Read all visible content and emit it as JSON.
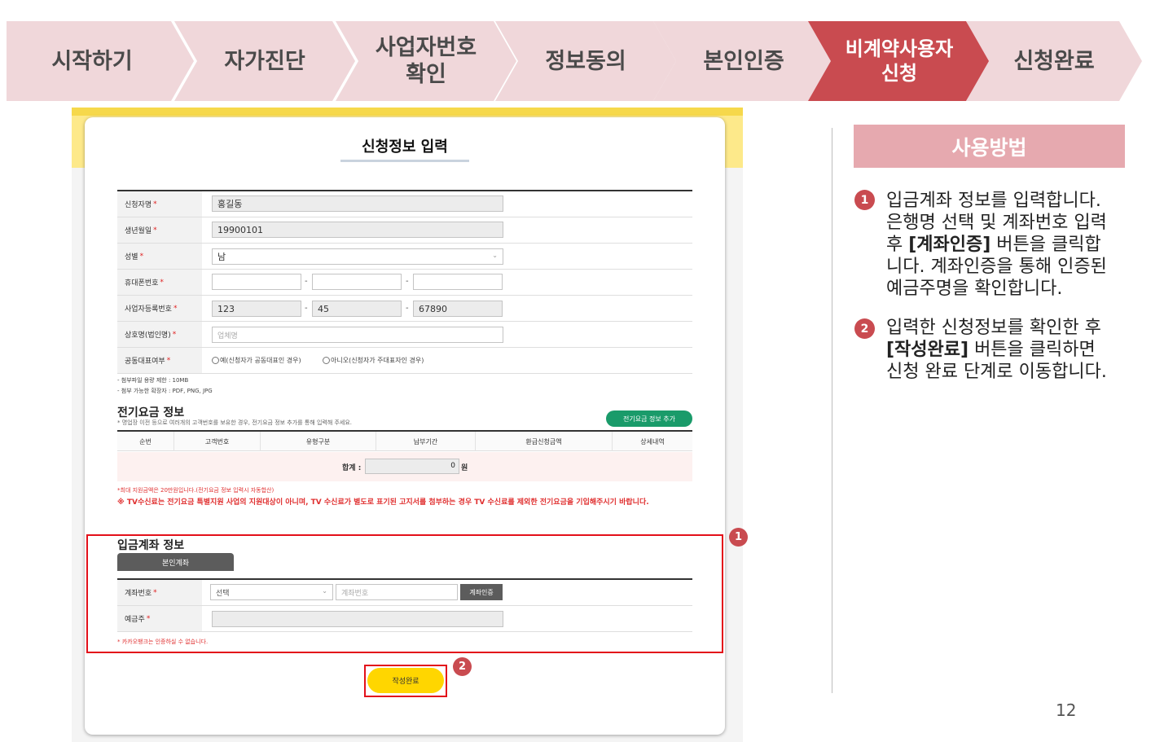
{
  "steps": [
    {
      "label": "시작하기"
    },
    {
      "label": "자가진단"
    },
    {
      "label": "사업자번호\n확인"
    },
    {
      "label": "정보동의"
    },
    {
      "label": "본인인증"
    },
    {
      "label": "비계약사용자\n신청",
      "active": true
    },
    {
      "label": "신청완료"
    }
  ],
  "colors": {
    "active_step": "#c94b50",
    "inactive_step": "#f0d7da",
    "highlight_box": "#e3101a",
    "submit_button": "#ffd600",
    "add_button": "#1a9b6a"
  },
  "form": {
    "title": "신청정보 입력",
    "applicant_name_label": "신청자명",
    "applicant_name_value": "홍길동",
    "birth_label": "생년월일",
    "birth_value": "19900101",
    "gender_label": "성별",
    "gender_value": "남",
    "phone_label": "휴대폰번호",
    "business_no_label": "사업자등록번호",
    "business_no": [
      "123",
      "45",
      "67890"
    ],
    "company_label": "상호명(법인명)",
    "company_placeholder": "업체명",
    "joint_rep_label": "공동대표여부",
    "joint_rep_yes": "예(신청자가 공동대표인 경우)",
    "joint_rep_no": "아니오(신청자가 주대표자인 경우)",
    "required_mark": "*",
    "dash": "-",
    "file_note_1": "- 첨부파일 용량 제한 : 10MB",
    "file_note_2": "- 첨부 가능한 확장자 : PDF, PNG, JPG"
  },
  "electric": {
    "title": "전기요금 정보",
    "subtitle": "* 명업장 이전 등으로 여러개의 고객번호를 보유한 경우, 전기요금 정보 추가를 통해 입력해 주세요.",
    "add_button": "전기요금 정보 추가",
    "columns": [
      "순번",
      "고객번호",
      "유형구분",
      "납부기간",
      "환급신청금액",
      "상세내역"
    ],
    "total_label": "합계 :",
    "total_value": "0",
    "total_unit": "원",
    "note_max": "*최대 지원금액은 20만원입니다.(전기요금 정보 입력시 자동합산)",
    "note_tv": "※ TV수신료는 전기요금 특별지원 사업의 지원대상이 아니며, TV 수신료가 별도로 표기된 고지서를 첨부하는 경우 TV 수신료를 제외한 전기요금을 기입해주시기 바랍니다."
  },
  "account": {
    "title": "입금계좌 정보",
    "tab": "본인계좌",
    "account_no_label": "계좌번호",
    "bank_select": "선택",
    "account_placeholder": "계좌번호",
    "verify_button": "계좌인증",
    "holder_label": "예금주",
    "note": "* 카카오뱅크는 인증하실 수 없습니다."
  },
  "submit_button": "작성완료",
  "badges": [
    "1",
    "2"
  ],
  "usage": {
    "title": "사용방법",
    "step1_lines": [
      "입금계좌 정보를 입력합니다.",
      "은행명 선택 및 계좌번호 입력",
      "후 ",
      "[계좌인증]",
      " 버튼을 클릭합",
      "니다. 계좌인증을 통해 인증된",
      "예금주명을 확인합니다."
    ],
    "step2_lines": [
      "입력한 신청정보를 확인한 후",
      "[작성완료]",
      " 버튼을 클릭하면",
      "신청 완료 단계로 이동합니다."
    ]
  },
  "page_number": "12"
}
